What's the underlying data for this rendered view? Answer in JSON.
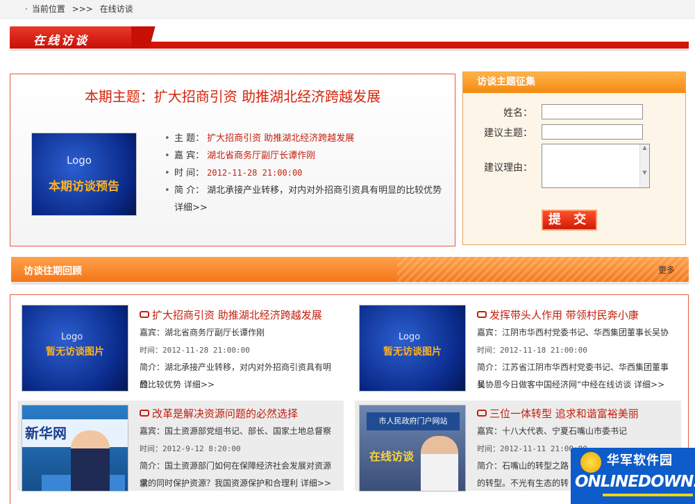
{
  "breadcrumb": {
    "label": "当前位置",
    "sep": ">>>",
    "current": "在线访谈"
  },
  "banner": {
    "title": "在线访谈"
  },
  "current_topic": {
    "heading": "本期主题：扩大招商引资  助推湖北经济跨越发展",
    "poster_logo": "Logo",
    "poster_caption": "本期访谈预告",
    "rows": [
      {
        "key": "主 题：",
        "value": "扩大招商引资  助推湖北经济跨越发展"
      },
      {
        "key": "嘉 宾：",
        "value": "湖北省商务厅副厅长谭作刚"
      },
      {
        "key": "时 间：",
        "value": "2012-11-28 21:00:00"
      },
      {
        "key": "简 介：",
        "value": "湖北承接产业转移，对内对外招商引资具有明显的比较优势",
        "more": "详细>>"
      }
    ]
  },
  "suggest_form": {
    "header": "访谈主题征集",
    "name_label": "姓名：",
    "topic_label": "建议主题：",
    "reason_label": "建议理由：",
    "submit_label": "提 交"
  },
  "past": {
    "header": "访谈往期回顾",
    "more": "更多",
    "items": [
      {
        "title": "扩大招商引资  助推湖北经济跨越发展",
        "guest": "嘉宾：湖北省商务厅副厅长谭作刚",
        "time": "时间：2012-11-28 21:00:00",
        "intro1": "简介：湖北承接产业转移，对内对外招商引资具有明显",
        "intro2": "的比较优势  详细>>",
        "thumb_logo": "Logo",
        "thumb_caption": "暂无访谈图片"
      },
      {
        "title": "发挥带头人作用 带领村民奔小康",
        "guest": "嘉宾：江阴市华西村党委书记、华西集团董事长吴协",
        "time": "时间：2012-11-18 21:00:00",
        "intro1": "简介：江苏省江阴市华西村党委书记、华西集团董事长",
        "intro2": "吴协恩今日做客中国经济网“中经在线访谈  详细>>",
        "thumb_logo": "Logo",
        "thumb_caption": "暂无访谈图片"
      },
      {
        "title": "改革是解决资源问题的必然选择",
        "guest": "嘉宾：国土资源部党组书记、部长、国家土地总督察",
        "time": "时间：2012-9-12 8:20:00",
        "intro1": "简介：国土资源部门如何在保障经济社会发展对资源需",
        "intro2": "求的同时保护资源？我国资源保护和合理利  详细>>",
        "thumb_banner": "新华网"
      },
      {
        "title": "三位一体转型  追求和谐富裕美丽",
        "guest": "嘉宾：十八大代表、宁夏石嘴山市委书记",
        "time": "时间：2012-11-11 21:00:00",
        "intro1": "简介：石嘴山的转型之路",
        "intro2": "的转型。不光有生态的转",
        "thumb_banner": "市人民政府门户网站",
        "thumb_caption": "在线访谈"
      }
    ]
  },
  "watermark": {
    "cn": "华军软件园",
    "en": "ONLINEDOWN.net"
  },
  "colors": {
    "accent_red": "#c21e0d",
    "orange": "#f37416",
    "border_red": "#e35a3e"
  }
}
